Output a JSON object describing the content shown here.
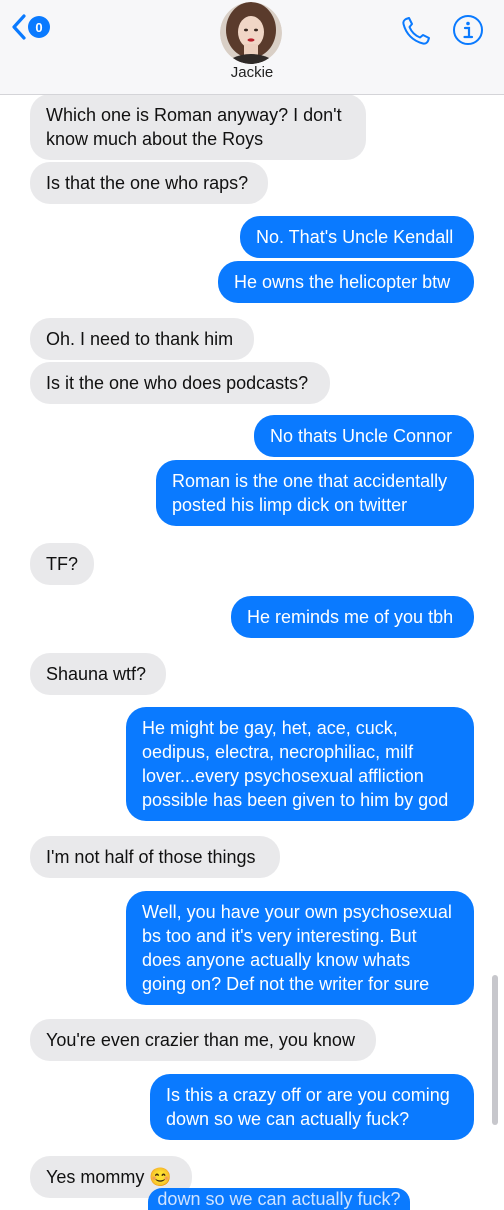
{
  "header": {
    "back_badge": "0",
    "contact_name": "Jackie",
    "icons": {
      "back": "chevron-left-icon",
      "phone": "phone-icon",
      "info": "info-icon"
    }
  },
  "messages": [
    {
      "side": "in",
      "text": "Which one is Roman anyway? I don't know much about the Roys"
    },
    {
      "side": "in",
      "text": "Is that the one who raps?"
    },
    {
      "side": "out",
      "text": "No. That's Uncle Kendall"
    },
    {
      "side": "out",
      "text": "He owns the helicopter btw"
    },
    {
      "side": "in",
      "text": "Oh. I need to thank him"
    },
    {
      "side": "in",
      "text": "Is it the one who does podcasts?"
    },
    {
      "side": "out",
      "text": "No thats Uncle Connor"
    },
    {
      "side": "out",
      "text": "Roman is the one that accidentally posted his limp dick on twitter"
    },
    {
      "side": "in",
      "text": "TF?"
    },
    {
      "side": "out",
      "text": "He reminds me of you tbh"
    },
    {
      "side": "in",
      "text": "Shauna wtf?"
    },
    {
      "side": "out",
      "text": "He might be gay, het, ace, cuck, oedipus, electra, necrophiliac, milf lover...every psychosexual affliction possible has been given to him by god"
    },
    {
      "side": "in",
      "text": "I'm not half of those things"
    },
    {
      "side": "out",
      "text": "Well, you have your own psychosexual bs too and it's very interesting. But does anyone actually know whats going on? Def not the writer for sure"
    },
    {
      "side": "in",
      "text": "You're even crazier than me, you know"
    },
    {
      "side": "out",
      "text": "Is this a crazy off or are you coming down so we can actually fuck?"
    },
    {
      "side": "in",
      "text": "Yes mommy 😊"
    }
  ],
  "cutoff_text": "down so we can actually fuck?",
  "colors": {
    "outgoing": "#0a7aff",
    "incoming": "#e9e9eb",
    "header_bg": "#f7f7f9"
  }
}
